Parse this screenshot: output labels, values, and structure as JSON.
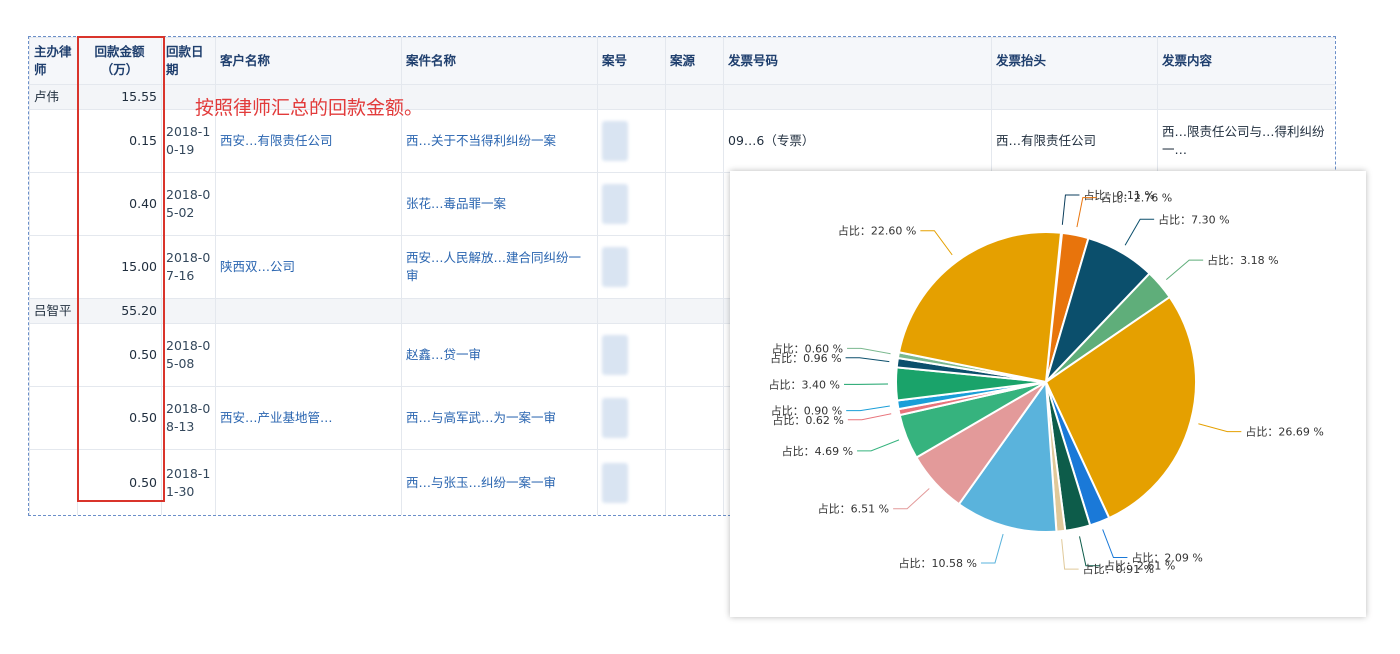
{
  "table": {
    "headers": [
      "主办律师",
      "回款金额（万）",
      "回款日期",
      "客户名称",
      "案件名称",
      "案号",
      "案源",
      "发票号码",
      "发票抬头",
      "发票内容"
    ],
    "groups": [
      {
        "lawyer": "卢伟",
        "total": "15.55",
        "rows": [
          {
            "amount": "0.15",
            "date": "2018-10-19",
            "client": "西安…有限责任公司",
            "case": "西…关于不当得利纠纷一案",
            "invoice_no": "09…6（专票）",
            "invoice_title": "西…有限责任公司",
            "invoice_content": "西…限责任公司与…得利纠纷一…"
          },
          {
            "amount": "0.40",
            "date": "2018-05-02",
            "client": "",
            "case": "张花…毒品罪一案",
            "invoice_no": "",
            "invoice_title": "",
            "invoice_content": ""
          },
          {
            "amount": "15.00",
            "date": "2018-07-16",
            "client": "陕西双…公司",
            "case": "西安…人民解放…建合同纠纷一审",
            "invoice_no": "",
            "invoice_title": "",
            "invoice_content": ""
          }
        ]
      },
      {
        "lawyer": "吕智平",
        "total": "55.20",
        "rows": [
          {
            "amount": "0.50",
            "date": "2018-05-08",
            "client": "",
            "case": "赵鑫…贷一审",
            "invoice_no": "",
            "invoice_title": "",
            "invoice_content": ""
          },
          {
            "amount": "0.50",
            "date": "2018-08-13",
            "client": "西安…产业基地管…",
            "case": "西…与高军武…为一案一审",
            "invoice_no": "",
            "invoice_title": "",
            "invoice_content": ""
          },
          {
            "amount": "0.50",
            "date": "2018-11-30",
            "client": "",
            "case": "西…与张玉…纠纷一案一审",
            "invoice_no": "",
            "invoice_title": "",
            "invoice_content": ""
          }
        ]
      }
    ]
  },
  "annotation": "按照律师汇总的回款金额。",
  "chart_data": {
    "type": "pie",
    "slices": [
      {
        "label": "占比：0.11 %",
        "value": 0.11,
        "color": "#0b3d5c"
      },
      {
        "label": "占比：2.76 %",
        "value": 2.76,
        "color": "#e8740c"
      },
      {
        "label": "占比：7.30 %",
        "value": 7.3,
        "color": "#0b4f6c"
      },
      {
        "label": "占比：3.18 %",
        "value": 3.18,
        "color": "#5fae7a"
      },
      {
        "label": "占比：26.69 %",
        "value": 26.69,
        "color": "#e5a000"
      },
      {
        "label": "占比：2.09 %",
        "value": 2.09,
        "color": "#1a79d8"
      },
      {
        "label": "占比：2.61 %",
        "value": 2.61,
        "color": "#0d5c4a"
      },
      {
        "label": "占比：0.91 %",
        "value": 0.91,
        "color": "#e0c99a"
      },
      {
        "label": "占比：10.58 %",
        "value": 10.58,
        "color": "#5ab3dc"
      },
      {
        "label": "占比：6.51 %",
        "value": 6.51,
        "color": "#e39a9a"
      },
      {
        "label": "占比：4.69 %",
        "value": 4.69,
        "color": "#36b37e"
      },
      {
        "label": "占比：0.62 %",
        "value": 0.62,
        "color": "#e8747c"
      },
      {
        "label": "占比：0.90 %",
        "value": 0.9,
        "color": "#1a9ed8"
      },
      {
        "label": "占比：3.40 %",
        "value": 3.4,
        "color": "#1aa36a"
      },
      {
        "label": "占比：0.96 %",
        "value": 0.96,
        "color": "#0b4f6c"
      },
      {
        "label": "占比：0.60 %",
        "value": 0.6,
        "color": "#7ab88e"
      },
      {
        "label": "占比：22.60 %",
        "value": 22.6,
        "color": "#e5a000"
      }
    ]
  }
}
